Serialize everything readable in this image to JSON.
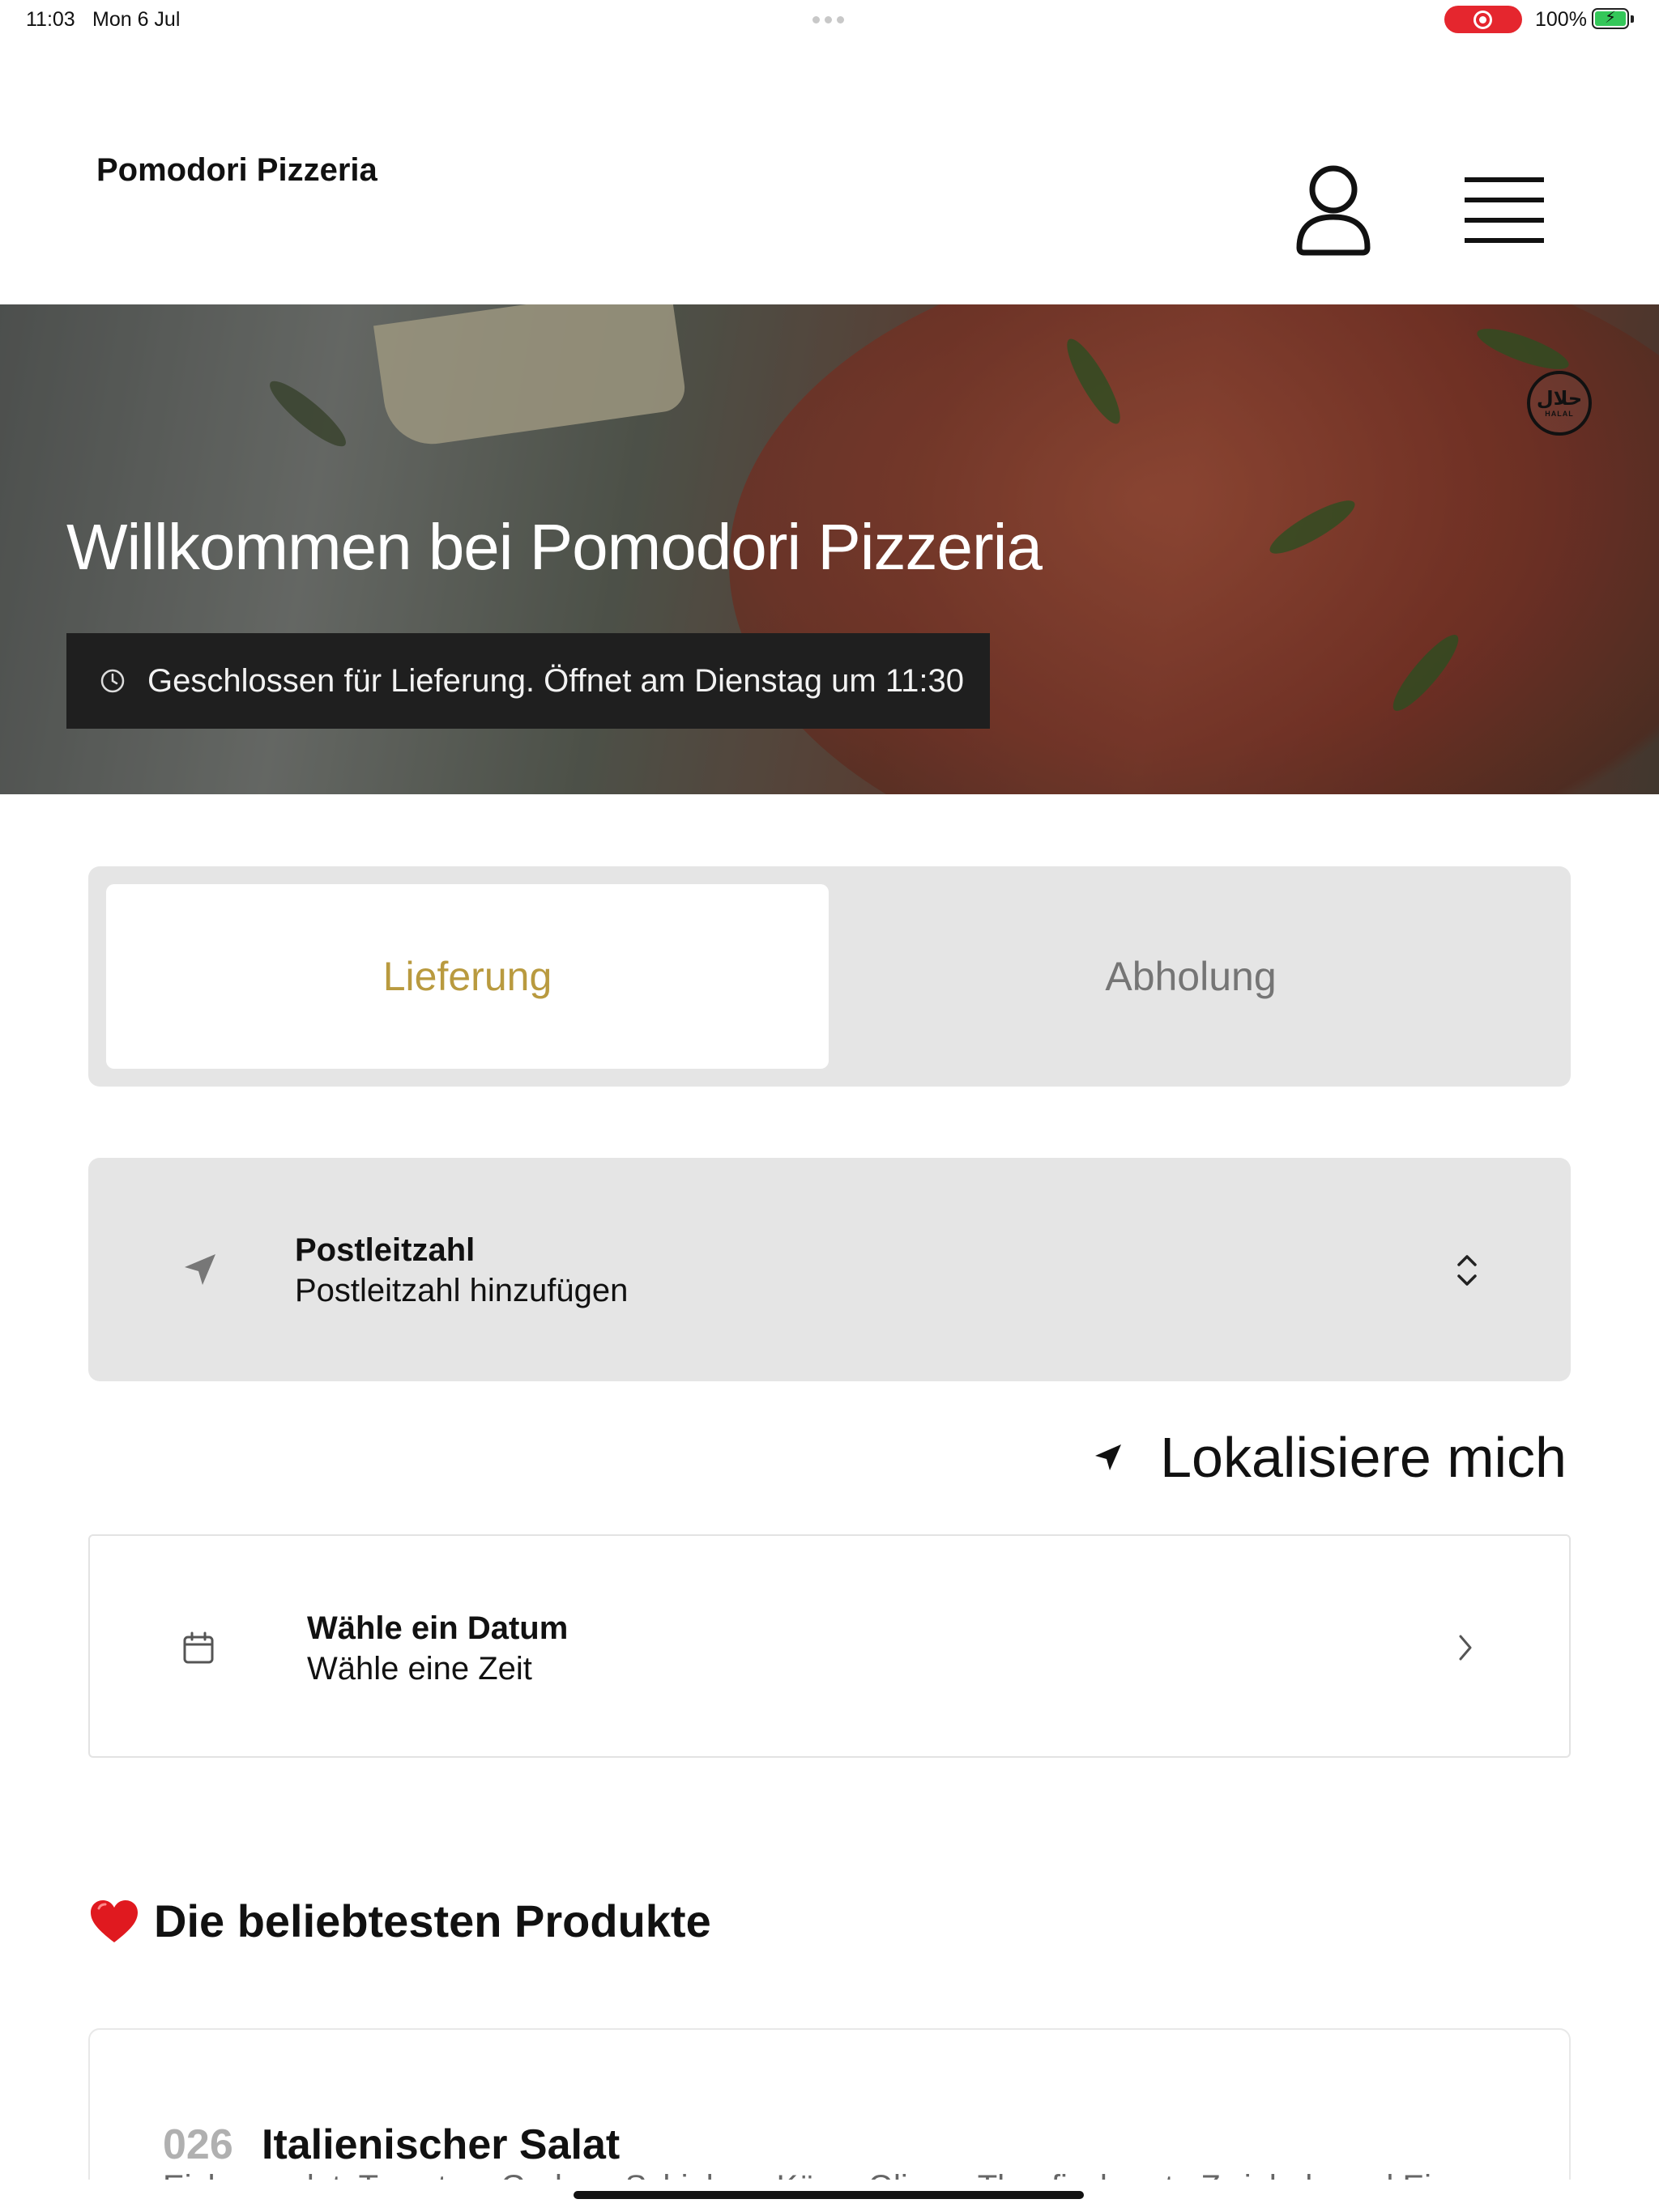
{
  "status_bar": {
    "time": "11:03",
    "date": "Mon 6 Jul",
    "battery_percent": "100%",
    "recording_color": "#e5262e",
    "battery_color": "#34c759"
  },
  "header": {
    "brand": "Pomodori Pizzeria",
    "user_icon": "user-icon",
    "menu_icon": "hamburger-menu-icon"
  },
  "hero": {
    "title": "Willkommen bei Pomodori Pizzeria",
    "status_text": "Geschlossen für Lieferung. Öffnet am Dienstag um 11:30",
    "badge_arabic": "حلال",
    "badge_latin": "HALAL"
  },
  "order_mode": {
    "options": [
      "Lieferung",
      "Abholung"
    ],
    "selected": "Lieferung",
    "accent_color": "#b99a3f"
  },
  "postal": {
    "title": "Postleitzahl",
    "placeholder": "Postleitzahl hinzufügen"
  },
  "locate": {
    "label": "Lokalisiere mich"
  },
  "schedule": {
    "title": "Wähle ein Datum",
    "subtitle": "Wähle eine Zeit"
  },
  "popular": {
    "emoji": "❤️",
    "heading": "Die beliebtesten Produkte",
    "products": [
      {
        "number": "026",
        "name": "Italienischer Salat",
        "description": "Eisbergsalat, Tomaten, Gurken, Schinken, Käse, Oliven, Thunfisch, rote Zwiebeln und Ei"
      }
    ]
  }
}
